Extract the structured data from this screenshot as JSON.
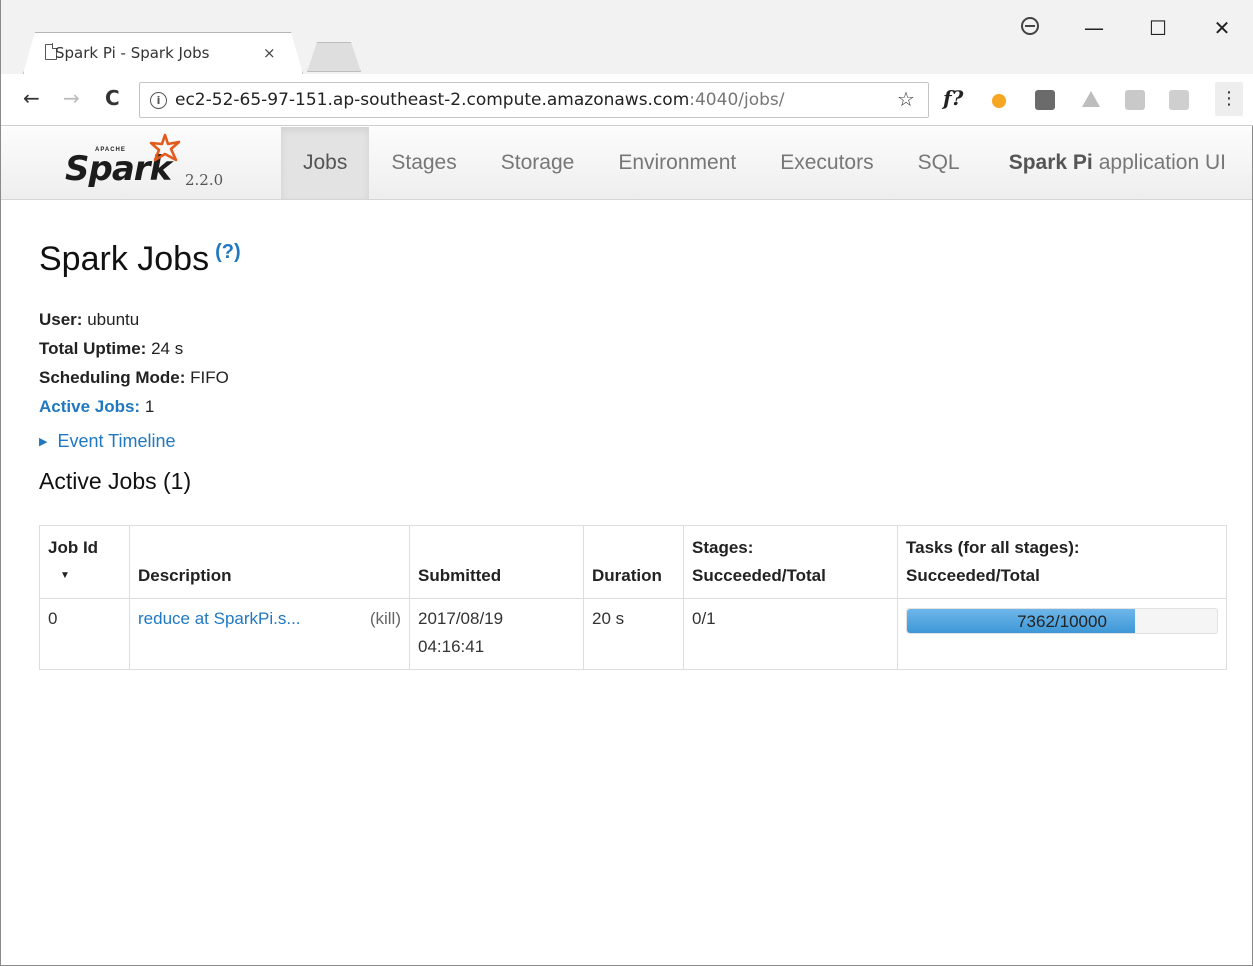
{
  "browser": {
    "tab_title": "Spark Pi - Spark Jobs",
    "tab_close": "×",
    "window_minimize": "—",
    "window_maximize": "☐",
    "window_close": "✕",
    "url_host": "ec2-52-65-97-151.ap-southeast-2.compute.amazonaws.com",
    "url_path": ":4040/jobs/",
    "back": "←",
    "forward": "→",
    "reload": "C",
    "info_glyph": "i",
    "star": "☆",
    "fx_ext": "f?",
    "menu": "⋮"
  },
  "navbar": {
    "brand_apache": "APACHE",
    "brand_spark": "Spark",
    "brand_version": "2.2.0",
    "items": [
      {
        "label": "Jobs",
        "active": true
      },
      {
        "label": "Stages"
      },
      {
        "label": "Storage"
      },
      {
        "label": "Environment"
      },
      {
        "label": "Executors"
      },
      {
        "label": "SQL"
      }
    ],
    "app_name": "Spark Pi",
    "app_suffix": "application UI"
  },
  "page": {
    "title": "Spark Jobs",
    "help": "(?)",
    "user_key": "User:",
    "user_val": "ubuntu",
    "uptime_key": "Total Uptime:",
    "uptime_val": "24 s",
    "mode_key": "Scheduling Mode:",
    "mode_val": "FIFO",
    "active_key": "Active Jobs:",
    "active_val": "1",
    "timeline_label": "Event Timeline",
    "active_section": "Active Jobs (1)"
  },
  "table": {
    "headers": {
      "job_id": "Job Id",
      "description": "Description",
      "submitted": "Submitted",
      "duration": "Duration",
      "stages_line1": "Stages:",
      "stages_line2": "Succeeded/Total",
      "tasks_line1": "Tasks (for all stages):",
      "tasks_line2": "Succeeded/Total"
    },
    "rows": [
      {
        "job_id": "0",
        "description": "reduce at SparkPi.s...",
        "kill": "(kill)",
        "submitted_date": "2017/08/19",
        "submitted_time": "04:16:41",
        "duration": "20 s",
        "stages": "0/1",
        "tasks": "7362/10000",
        "tasks_fraction": 0.7362
      }
    ]
  },
  "colors": {
    "link": "#1f78c1",
    "progress": "#3d98d6"
  }
}
